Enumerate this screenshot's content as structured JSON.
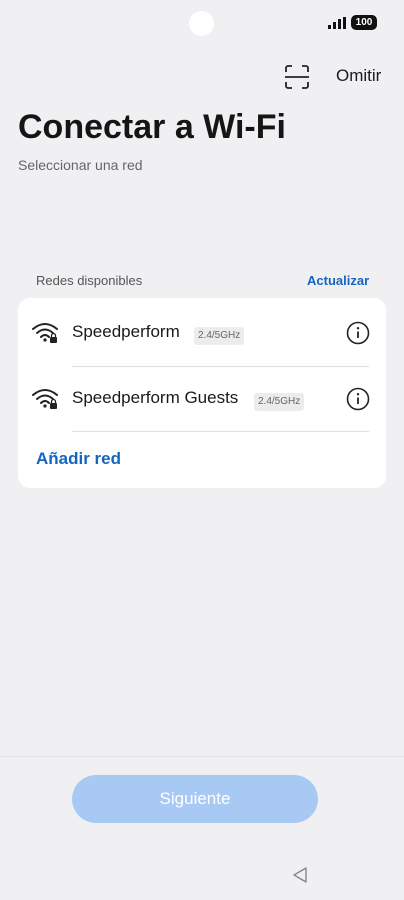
{
  "status_bar": {
    "battery": "100",
    "signal_icon": "signal-bars-icon"
  },
  "header": {
    "skip_label": "Omitir",
    "scan_icon": "scan-qr-icon"
  },
  "page": {
    "title": "Conectar a Wi-Fi",
    "subtitle": "Seleccionar una red"
  },
  "networks_section": {
    "label": "Redes disponibles",
    "refresh_label": "Actualizar",
    "networks": [
      {
        "name": "Speedperform",
        "band": "2.4/5GHz",
        "secured": true
      },
      {
        "name": "Speedperform Guests",
        "band": "2.4/5GHz",
        "secured": true
      }
    ],
    "add_network_label": "Añadir red"
  },
  "footer": {
    "next_label": "Siguiente"
  },
  "colors": {
    "accent": "#1565c0",
    "button_disabled": "#a9c9f5",
    "background": "#f0f0f3"
  }
}
